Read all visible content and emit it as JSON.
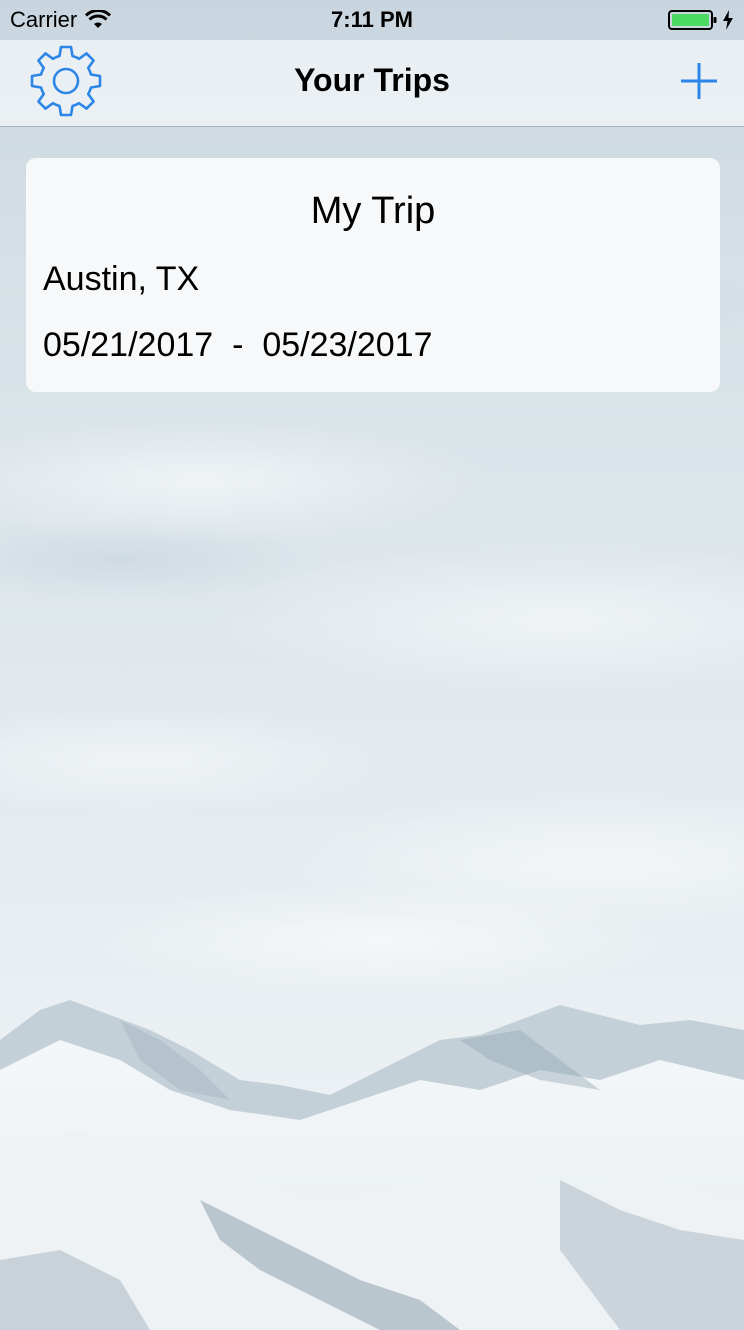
{
  "status_bar": {
    "carrier": "Carrier",
    "time": "7:11 PM",
    "battery_level": 1.0
  },
  "nav": {
    "title": "Your Trips",
    "left_icon": "gear-icon",
    "right_icon": "plus-icon"
  },
  "trips": [
    {
      "name": "My Trip",
      "location": "Austin, TX",
      "start_date": "05/21/2017",
      "separator": "-",
      "end_date": "05/23/2017"
    }
  ],
  "colors": {
    "accent": "#2c86e8",
    "battery": "#4cd964"
  }
}
